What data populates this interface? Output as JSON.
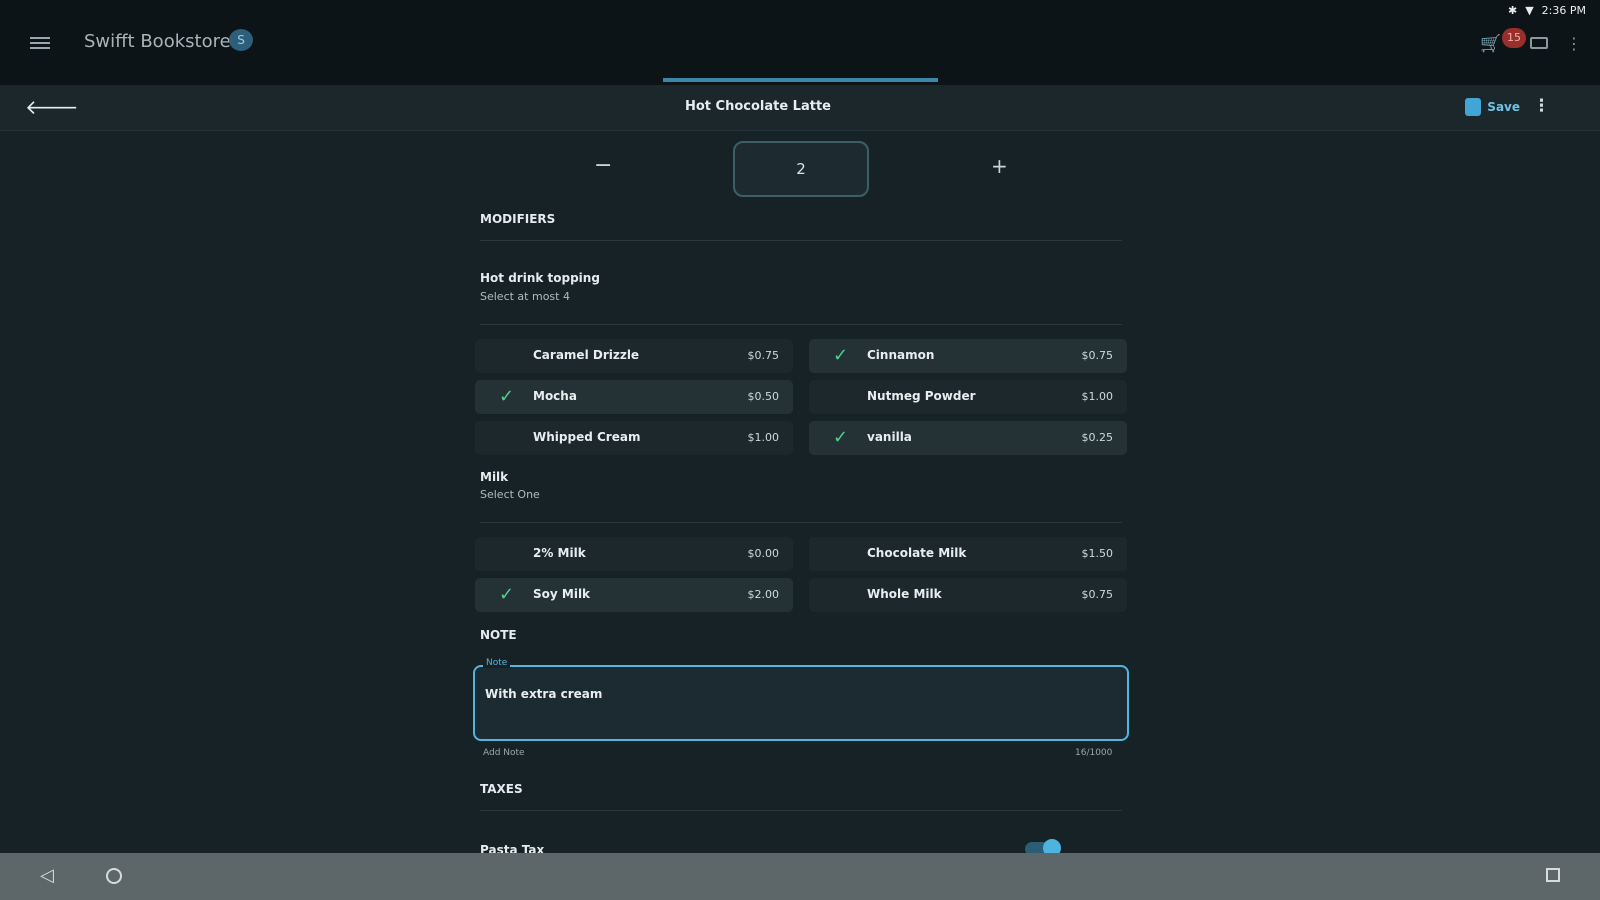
{
  "status": {
    "icons": "bluetooth-icon wifi-icon",
    "time": "2:36 PM"
  },
  "app": {
    "title": "Swifft Bookstore",
    "store_badge": "S",
    "cart_count": "15"
  },
  "panel": {
    "title": "Hot Chocolate Latte",
    "save_label": "Save"
  },
  "quantity": {
    "value": "2",
    "minus": "−",
    "plus": "+"
  },
  "modifiers": {
    "section_label": "MODIFIERS",
    "groups": [
      {
        "title": "Hot drink topping",
        "subtitle": "Select at most 4",
        "options": [
          {
            "name": "Caramel Drizzle",
            "price": "$0.75",
            "checked": false
          },
          {
            "name": "Cinnamon",
            "price": "$0.75",
            "checked": true
          },
          {
            "name": "Mocha",
            "price": "$0.50",
            "checked": true
          },
          {
            "name": "Nutmeg Powder",
            "price": "$1.00",
            "checked": false
          },
          {
            "name": "Whipped Cream",
            "price": "$1.00",
            "checked": false
          },
          {
            "name": "vanilla",
            "price": "$0.25",
            "checked": true
          }
        ]
      },
      {
        "title": "Milk",
        "subtitle": "Select One",
        "options": [
          {
            "name": "2% Milk",
            "price": "$0.00",
            "checked": false
          },
          {
            "name": "Chocolate Milk",
            "price": "$1.50",
            "checked": false
          },
          {
            "name": "Soy Milk",
            "price": "$2.00",
            "checked": true
          },
          {
            "name": "Whole Milk",
            "price": "$0.75",
            "checked": false
          }
        ]
      }
    ]
  },
  "note": {
    "section_label": "NOTE",
    "floating_label": "Note",
    "value": "With extra cream",
    "helper": "Add Note",
    "counter": "16/1000"
  },
  "taxes": {
    "section_label": "TAXES",
    "first_tax": "Pasta Tax",
    "toggle_on": true
  },
  "colors": {
    "accent": "#53b6dc",
    "check": "#4fd08f",
    "badge": "#9a2e2a"
  }
}
